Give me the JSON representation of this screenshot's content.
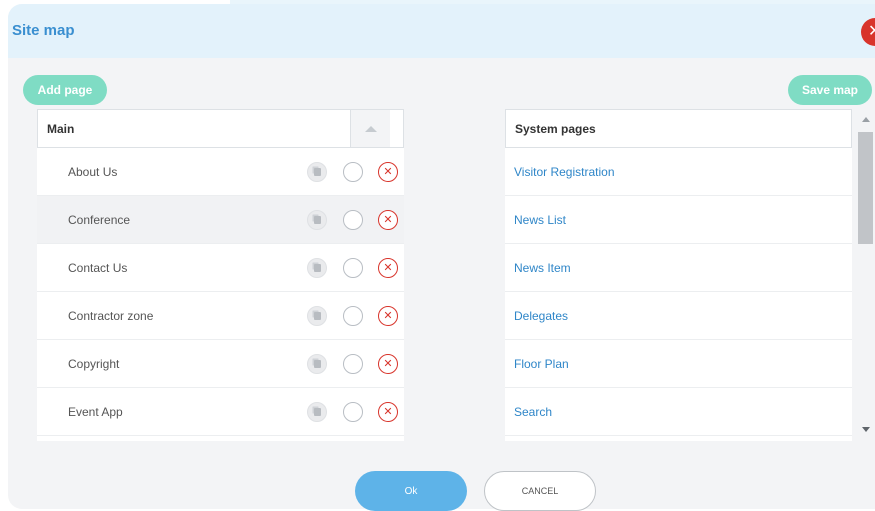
{
  "dialog": {
    "title": "Site map",
    "close_icon": "close-icon",
    "add_page_label": "Add page",
    "save_map_label": "Save map"
  },
  "main_panel": {
    "header": "Main",
    "pages": [
      {
        "name": "About Us",
        "highlighted": false
      },
      {
        "name": "Conference",
        "highlighted": true
      },
      {
        "name": "Contact Us",
        "highlighted": false
      },
      {
        "name": "Contractor zone",
        "highlighted": false
      },
      {
        "name": "Copyright",
        "highlighted": false
      },
      {
        "name": "Event App",
        "highlighted": false
      }
    ]
  },
  "system_panel": {
    "header": "System pages",
    "pages": [
      "Visitor Registration",
      "News List",
      "News Item",
      "Delegates",
      "Floor Plan",
      "Search"
    ]
  },
  "footer": {
    "ok_label": "Ok",
    "cancel_label": "CANCEL"
  },
  "colors": {
    "accent": "#3a8fd0",
    "pill_green": "#7fdcc4",
    "danger": "#d8342b",
    "link": "#2f86c8",
    "ok_button": "#5eb3e8"
  }
}
